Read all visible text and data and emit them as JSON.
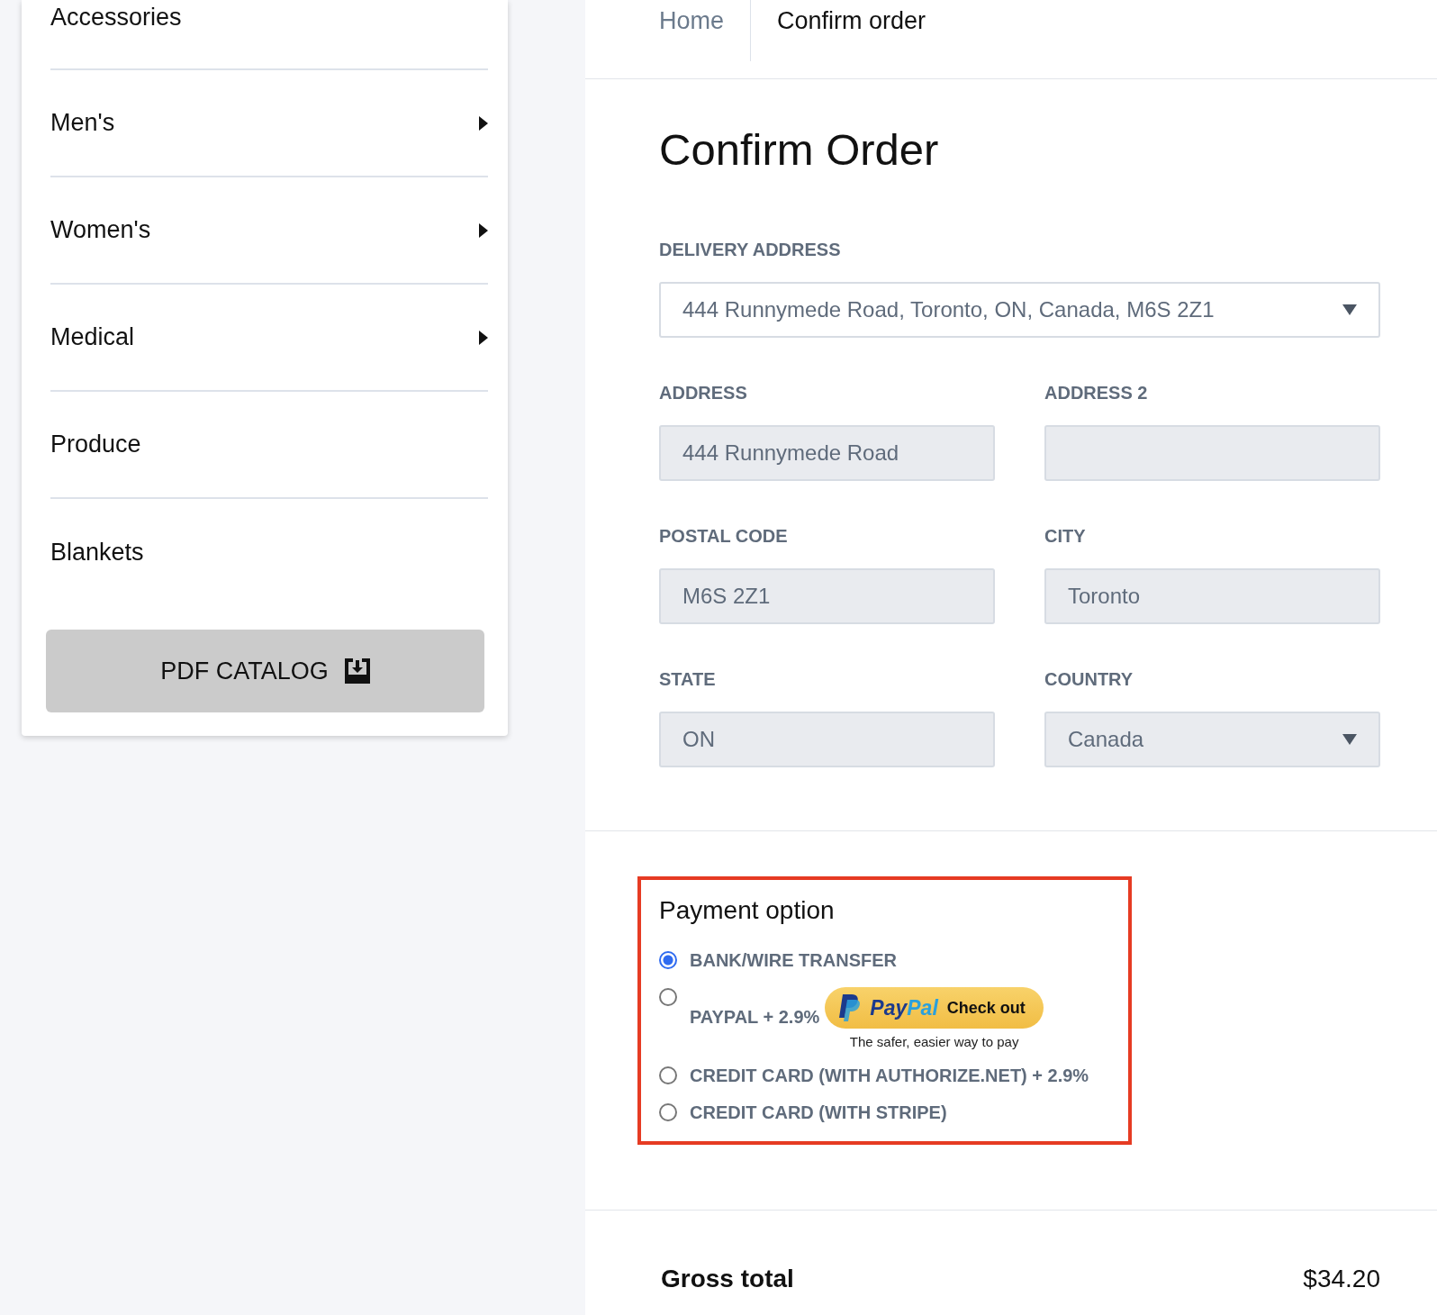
{
  "sidebar": {
    "items": [
      {
        "label": "Accessories",
        "submenu": false
      },
      {
        "label": "Men's",
        "submenu": true
      },
      {
        "label": "Women's",
        "submenu": true
      },
      {
        "label": "Medical",
        "submenu": true
      },
      {
        "label": "Produce",
        "submenu": false
      },
      {
        "label": "Blankets",
        "submenu": false
      }
    ],
    "catalog_button": "PDF CATALOG"
  },
  "breadcrumb": [
    {
      "label": "Home",
      "selected": false
    },
    {
      "label": "Confirm order",
      "selected": true
    }
  ],
  "title": "Confirm Order",
  "delivery": {
    "label": "DELIVERY ADDRESS",
    "value": "444 Runnymede Road, Toronto, ON, Canada, M6S 2Z1"
  },
  "fields": [
    {
      "label": "ADDRESS",
      "value": "444 Runnymede Road",
      "kind": "input"
    },
    {
      "label": "ADDRESS 2",
      "kind": "input"
    },
    {
      "label": "POSTAL CODE",
      "value": "M6S 2Z1",
      "kind": "input"
    },
    {
      "label": "CITY",
      "value": "Toronto",
      "kind": "input"
    },
    {
      "label": "STATE",
      "value": "ON",
      "kind": "input"
    },
    {
      "label": "COUNTRY",
      "value": "Canada",
      "kind": "select"
    }
  ],
  "payment": {
    "title": "Payment option",
    "options": [
      {
        "label": "BANK/WIRE TRANSFER",
        "selected": true
      },
      {
        "label": "PAYPAL + 2.9%",
        "selected": false,
        "paypal": {
          "brand_pay": "Pay",
          "brand_pal": "Pal",
          "action": "Check out",
          "tagline": "The safer, easier way to pay"
        }
      },
      {
        "label": "CREDIT CARD (WITH AUTHORIZE.NET) + 2.9%",
        "selected": false
      },
      {
        "label": "CREDIT CARD (WITH STRIPE)",
        "selected": false
      }
    ]
  },
  "totals": [
    {
      "label": "Gross total",
      "value": "$34.20"
    }
  ]
}
